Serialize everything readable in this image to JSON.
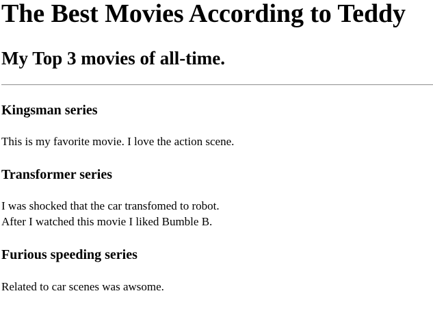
{
  "page": {
    "title": "The Best Movies According to Teddy",
    "subtitle": "My Top 3 movies of all-time."
  },
  "movies": [
    {
      "title": "Kingsman series",
      "lines": [
        "This is my favorite movie. I love the action scene."
      ]
    },
    {
      "title": "Transformer series",
      "lines": [
        "I was shocked that the car transfomed to robot.",
        "After I watched this movie I liked Bumble B."
      ]
    },
    {
      "title": "Furious speeding series",
      "lines": [
        "Related to car scenes was awsome."
      ]
    }
  ]
}
